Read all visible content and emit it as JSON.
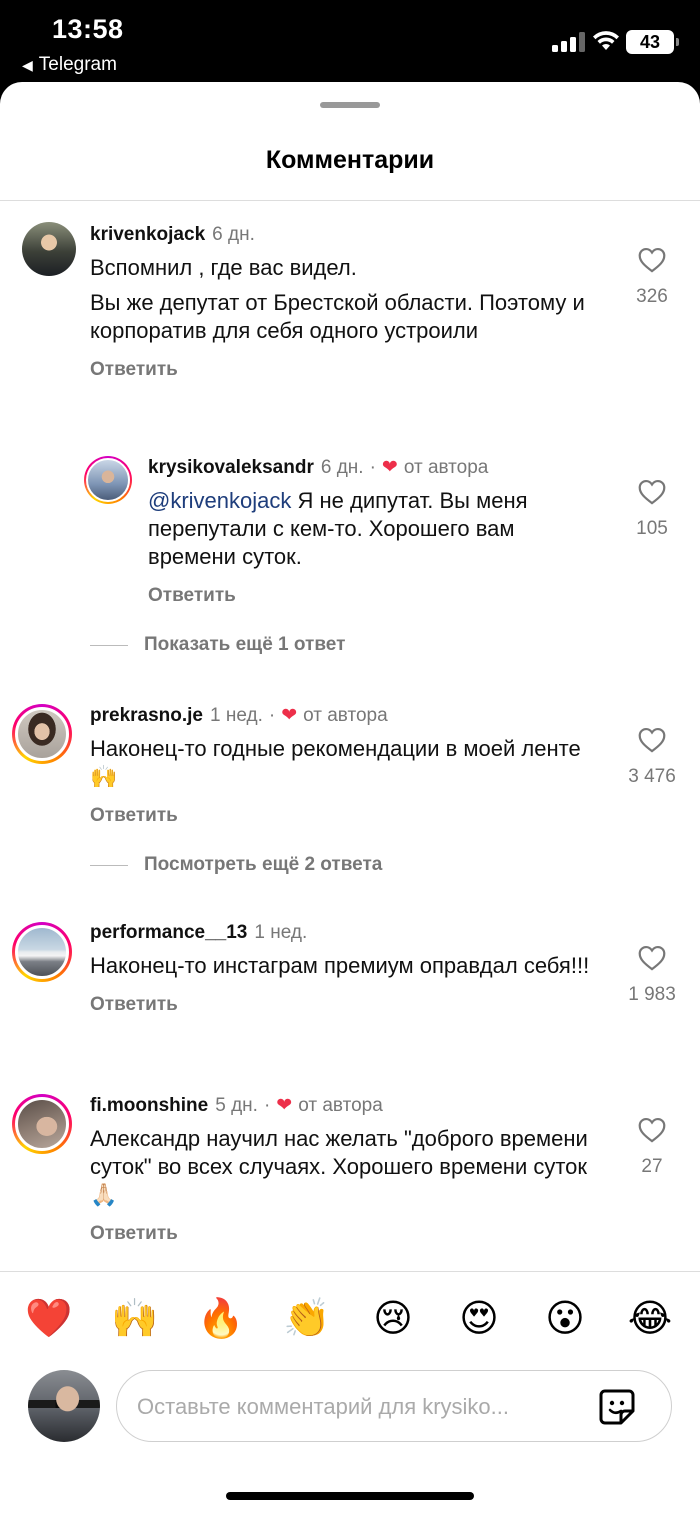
{
  "status_bar": {
    "time": "13:58",
    "back_app": "Telegram",
    "battery": "43",
    "icons": [
      "cellular-signal-icon",
      "wifi-icon",
      "battery-icon"
    ]
  },
  "header": {
    "title": "Комментарии"
  },
  "comments": [
    {
      "username": "krivenkojack",
      "time": "6 дн.",
      "paragraphs": [
        "Вспомнил , где вас видел.",
        "Вы же депутат от Брестской области. Поэтому и корпоратив для себя одного устроили"
      ],
      "reply_label": "Ответить",
      "likes": "326"
    },
    {
      "username": "krysikovaleksandr",
      "time": "6 дн.",
      "author_badge": "от автора",
      "mention": "@krivenkojack",
      "text": " Я не дипутат. Вы меня перепутали с кем-то. Хорошего вам времени суток.",
      "reply_label": "Ответить",
      "likes": "105"
    },
    {
      "username": "prekrasno.je",
      "time": "1 нед.",
      "author_badge": "от автора",
      "text": "Наконец-то годные рекомендации в моей ленте 🙌",
      "reply_label": "Ответить",
      "likes": "3 476"
    },
    {
      "username": "performance__13",
      "time": "1 нед.",
      "text": "Наконец-то инстаграм премиум оправдал себя!!!",
      "reply_label": "Ответить",
      "likes": "1 983"
    },
    {
      "username": "fi.moonshine",
      "time": "5 дн.",
      "author_badge": "от автора",
      "text": "Александр научил нас  желать \"доброго времени суток\" во всех случаях. Хорошего времени суток 🙏🏻",
      "reply_label": "Ответить",
      "likes": "27"
    }
  ],
  "more_replies": [
    "Показать ещё 1 ответ",
    "Посмотреть ещё 2 ответа"
  ],
  "reactions": [
    "❤️",
    "🙌",
    "🔥",
    "👏",
    "😢",
    "😍",
    "😮",
    "😂"
  ],
  "composer": {
    "placeholder": "Оставьте комментарий для krysiko..."
  },
  "colors": {
    "heart_red": "#ed2f4a",
    "mention": "#1e3d7b",
    "muted": "#777777"
  }
}
